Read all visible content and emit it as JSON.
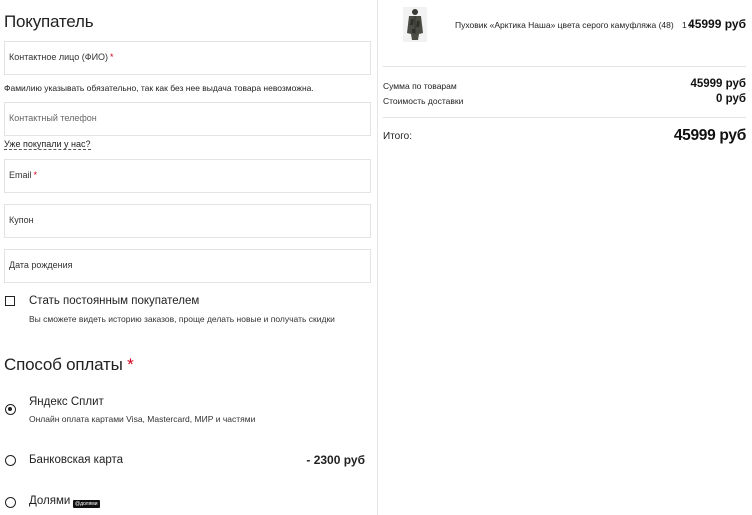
{
  "buyer": {
    "title": "Покупатель",
    "contact_person_label": "Контактное лицо (ФИО)",
    "required_mark": "*",
    "contact_person_hint": "Фамилию указывать обязательно, так как без нее выдача товара невозможна.",
    "phone_placeholder": "Контактный телефон",
    "bought_before_link": "Уже покупали у нас?",
    "email_label": "Email",
    "coupon_label": "Купон",
    "birthdate_label": "Дата рождения",
    "regular_customer": {
      "title": "Стать постоянным покупателем",
      "subtitle": "Вы сможете видеть историю заказов, проще делать новые и получать скидки",
      "checked": false
    }
  },
  "payment": {
    "title": "Способ оплаты",
    "required_mark": "*",
    "methods": [
      {
        "title": "Яндекс Сплит",
        "subtitle": "Онлайн оплата картами Visa, Mastercard, МИР и частями",
        "price": "",
        "badge": "",
        "selected": true
      },
      {
        "title": "Банковская карта",
        "subtitle": "",
        "price": "- 2300 руб",
        "badge": "",
        "selected": false
      },
      {
        "title": "Долями",
        "subtitle": "",
        "price": "",
        "badge": "@долями",
        "selected": false
      }
    ]
  },
  "cart": {
    "item": {
      "name": "Пуховик «Арктика Наша» цвета серого камуфляжа (48)",
      "qty": "1 x",
      "price": "45999 руб",
      "image_icon": "jacket-thumbnail"
    },
    "summary": {
      "goods_label": "Сумма по товарам",
      "goods_value": "45999 руб",
      "delivery_label": "Стоимость доставки",
      "delivery_value": "0 руб"
    },
    "total_label": "Итого:",
    "total_value": "45999 руб"
  },
  "colors": {
    "required": "#d0021b",
    "border": "#e3e3e3",
    "text": "#222222"
  }
}
